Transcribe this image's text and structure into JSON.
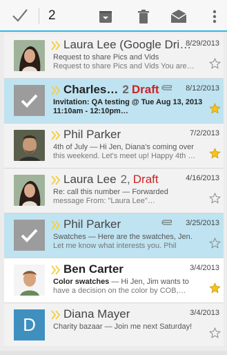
{
  "toolbar": {
    "selected_count": "2",
    "actions": [
      "done-icon",
      "archive-icon",
      "delete-icon",
      "mark-unread-icon",
      "overflow-menu-icon"
    ]
  },
  "accent_color": "#33b5e5",
  "selected_row_color": "#bfe3f1",
  "messages": [
    {
      "sender": "Laura Lee (Google Dri…",
      "date": "8/29/2013",
      "subject": "Request to share Pics and Vids",
      "snippet_line1": "",
      "line3": "Request to share Pics and Vids You are…",
      "starred": false,
      "selected": false
    },
    {
      "sender": "Charles…",
      "count": "2",
      "draft_label": "Draft",
      "date": "8/12/2013",
      "line2": "Invitation: QA testing @ Tue Aug 13, 2013",
      "line3": "11:10am - 12:10pm…",
      "starred": true,
      "selected": true,
      "attachment": true
    },
    {
      "sender": "Phil Parker",
      "date": "7/2/2013",
      "line2": "4th of July — Hi Jen, Diana's coming over",
      "line3": "this weekend. Let's meet up! Happy 4th …",
      "starred": true,
      "selected": false
    },
    {
      "sender": "Laura Lee",
      "count": "2,",
      "draft_label": "Draft",
      "date": "4/16/2013",
      "line2": "Re: call this number — Forwarded",
      "line3": "message From: \"Laura Lee\"…",
      "starred": false,
      "selected": false
    },
    {
      "sender": "Phil Parker",
      "date": "3/25/2013",
      "line2": "Swatches — Here are the swatches, Jen.",
      "line3": "Let me know what interests you. Phil",
      "starred": false,
      "selected": true,
      "attachment": true
    },
    {
      "sender": "Ben Carter",
      "date": "3/4/2013",
      "line2_subject": "Color swatches",
      "line2_rest": " — Hi Jen, Jim wants to",
      "line3": "have a decision on the color by COB,…",
      "starred": true,
      "selected": false
    },
    {
      "sender": "Diana Mayer",
      "date": "3/4/2013",
      "avatar_letter": "D",
      "line2": "Charity bazaar — Join me next Saturday!",
      "line3": "",
      "starred": false,
      "selected": false
    }
  ]
}
